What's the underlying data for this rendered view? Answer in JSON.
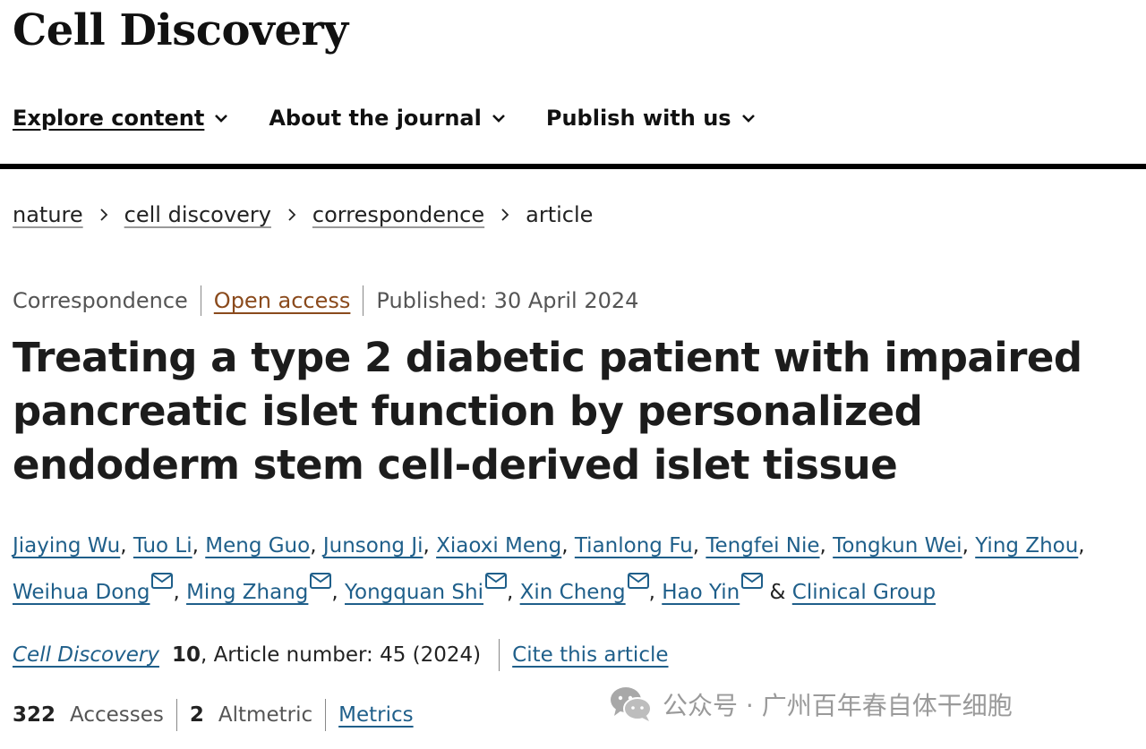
{
  "journal": {
    "name": "Cell Discovery"
  },
  "nav": {
    "items": [
      {
        "label": "Explore content"
      },
      {
        "label": "About the journal"
      },
      {
        "label": "Publish with us"
      }
    ]
  },
  "breadcrumb": {
    "items": [
      "nature",
      "cell discovery",
      "correspondence"
    ],
    "current": "article"
  },
  "article": {
    "type": "Correspondence",
    "access": "Open access",
    "published": "Published: 30 April 2024",
    "title": "Treating a type 2 diabetic patient with impaired pancreatic islet function by personalized endoderm stem cell-derived islet tissue"
  },
  "authors": {
    "list": [
      {
        "name": "Jiaying Wu"
      },
      {
        "name": "Tuo Li"
      },
      {
        "name": "Meng Guo"
      },
      {
        "name": "Junsong Ji"
      },
      {
        "name": "Xiaoxi Meng"
      },
      {
        "name": "Tianlong Fu"
      },
      {
        "name": "Tengfei Nie"
      },
      {
        "name": "Tongkun Wei"
      },
      {
        "name": "Ying Zhou"
      },
      {
        "name": "Weihua Dong"
      },
      {
        "name": "Ming Zhang"
      },
      {
        "name": "Yongquan Shi"
      },
      {
        "name": "Xin Cheng"
      },
      {
        "name": "Hao Yin"
      }
    ],
    "conjunction": "&",
    "group": "Clinical Group"
  },
  "citation": {
    "journal": "Cell Discovery",
    "volume": "10",
    "article_number": ", Article number: 45 (2024)",
    "cite_label": "Cite this article"
  },
  "stats": {
    "accesses_count": "322",
    "accesses_label": "Accesses",
    "altmetric_count": "2",
    "altmetric_label": "Altmetric",
    "metrics_label": "Metrics"
  },
  "watermark": {
    "text": "公众号 · 广州百年春自体干细胞",
    "icon": "wechat-icon"
  },
  "colors": {
    "link": "#1f5f8a",
    "open_access": "#8a4a1c",
    "rule": "#000000"
  }
}
